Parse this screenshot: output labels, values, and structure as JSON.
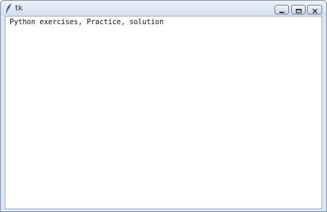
{
  "window": {
    "title": "tk",
    "controls": {
      "minimize": "minimize-icon",
      "maximize": "maximize-icon",
      "close": "close-icon"
    }
  },
  "content": {
    "label": "Python exercises, Practice, solution"
  },
  "colors": {
    "titlebar": "#dce6f2",
    "frame": "#dbe6f3",
    "content_bg": "#ffffff"
  }
}
